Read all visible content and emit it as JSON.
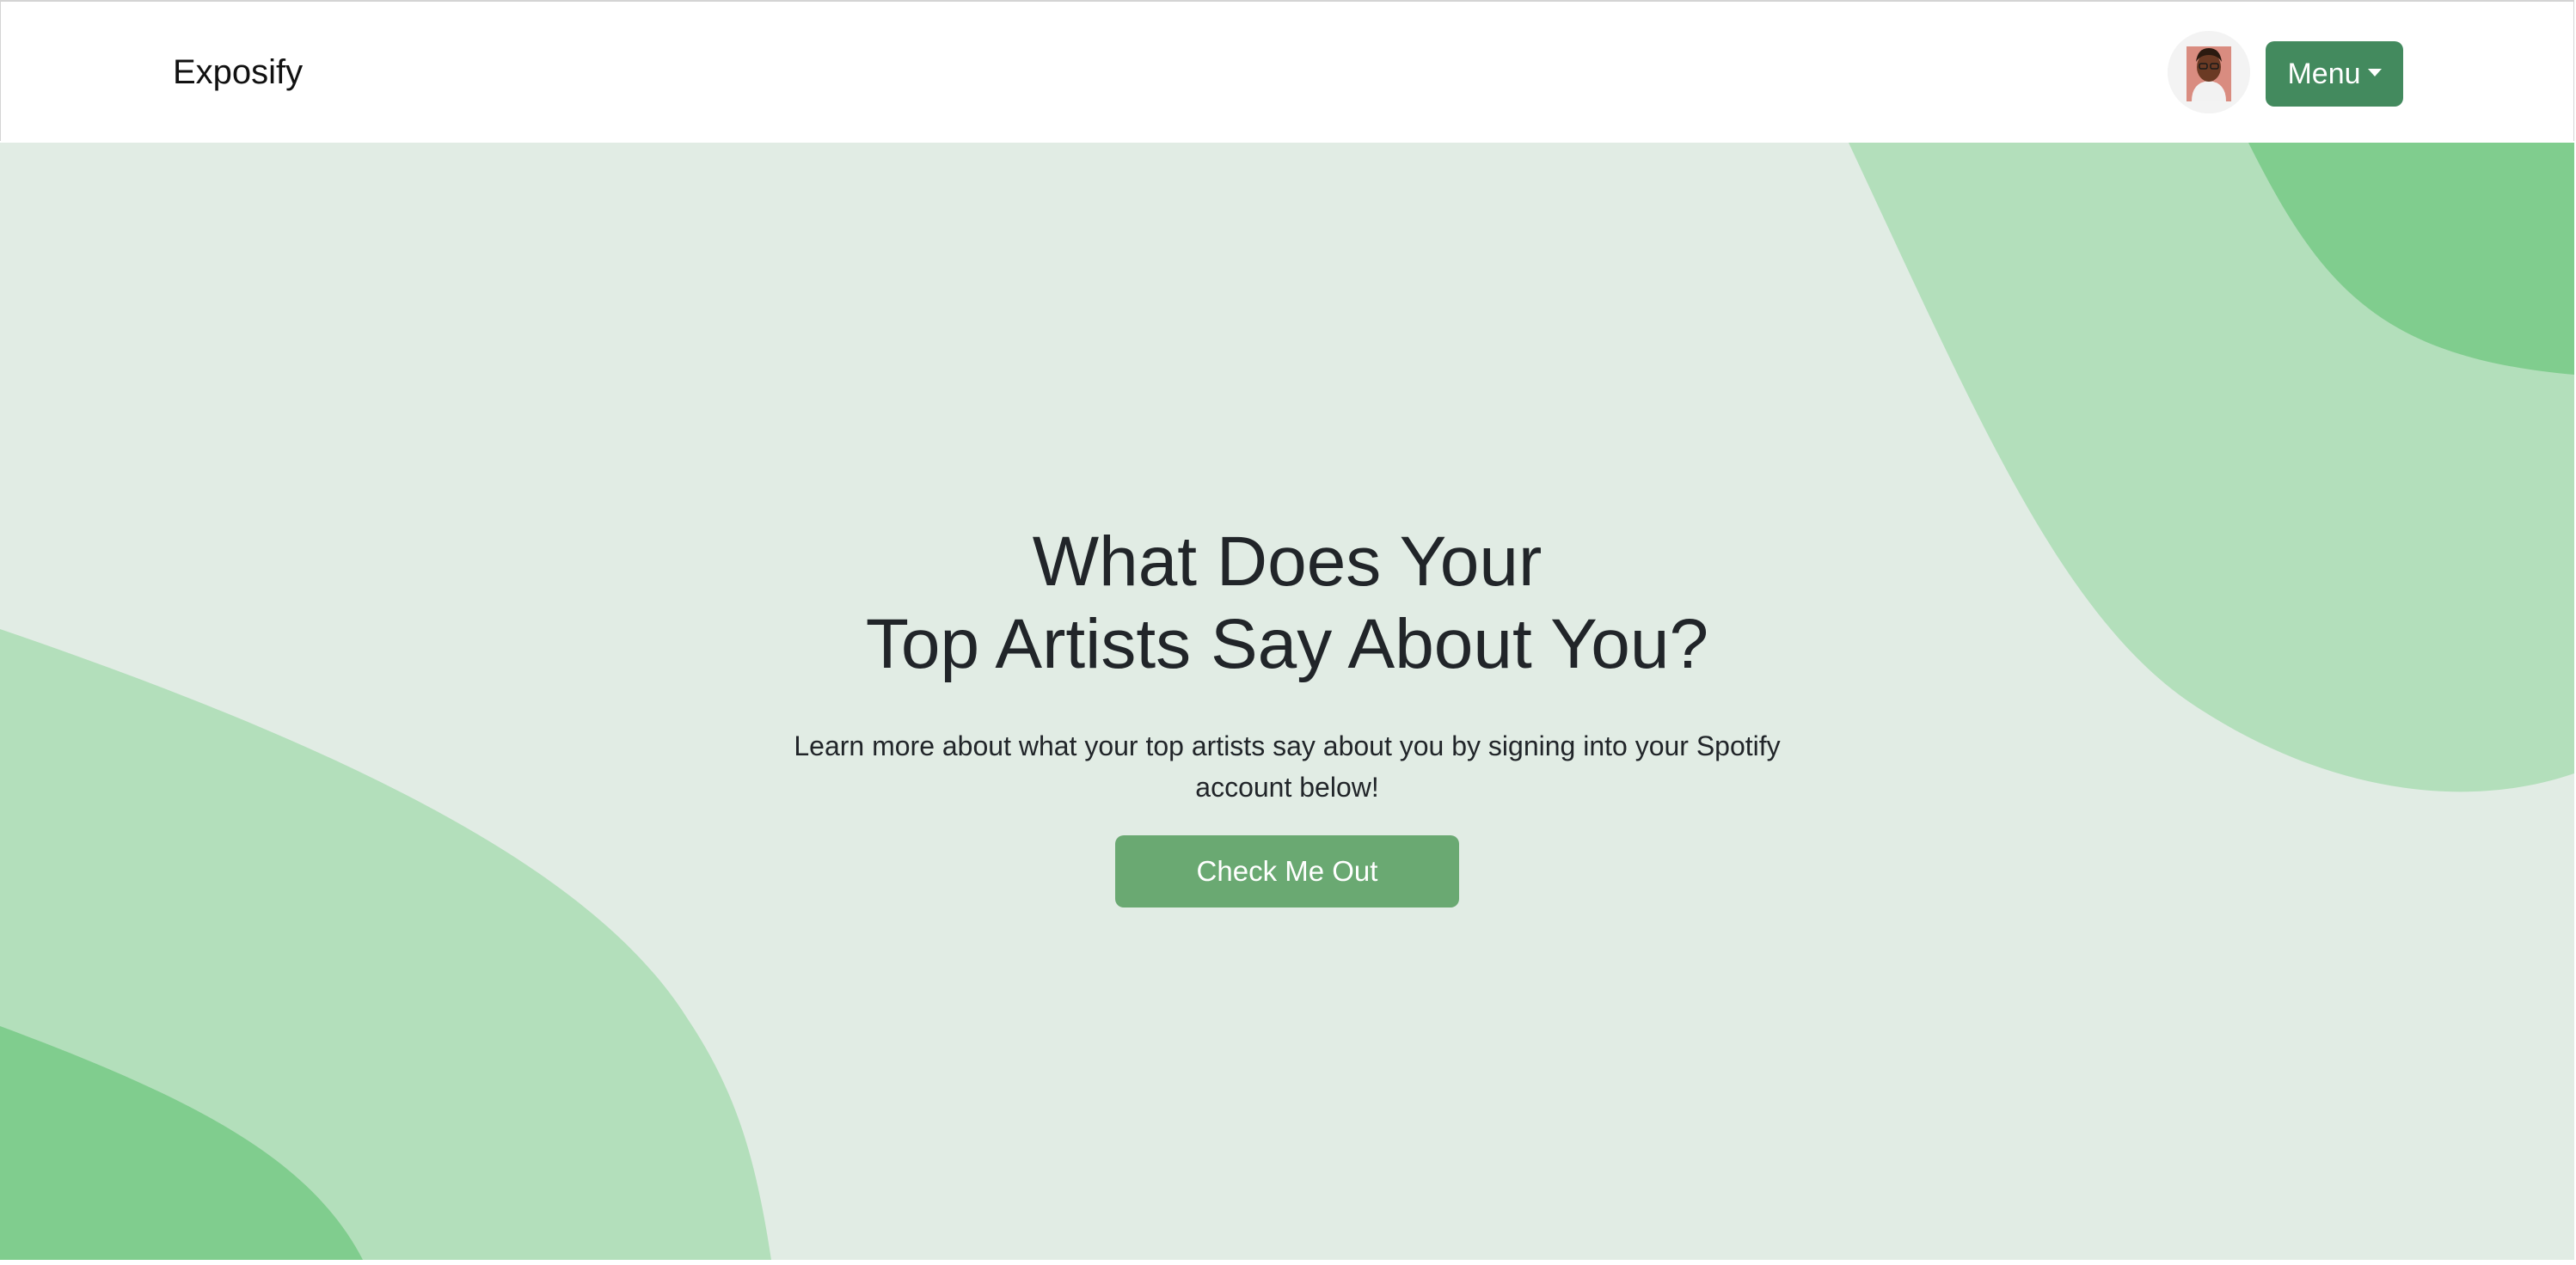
{
  "navbar": {
    "brand": "Exposify",
    "menu_label": "Menu"
  },
  "hero": {
    "title_line1": "What Does Your",
    "title_line2": "Top Artists Say About You?",
    "subtitle": "Learn more about what your top artists say about you by signing into your Spotify account below!",
    "cta_label": "Check Me Out"
  },
  "colors": {
    "hero_bg": "#e1ece4",
    "blob_light": "#b3dfbb",
    "blob_dark": "#80cd8e",
    "menu_button": "#438a5e",
    "cta_button": "#6aa972"
  },
  "icons": {
    "avatar": "user-avatar-icon",
    "menu_caret": "caret-down-icon"
  }
}
